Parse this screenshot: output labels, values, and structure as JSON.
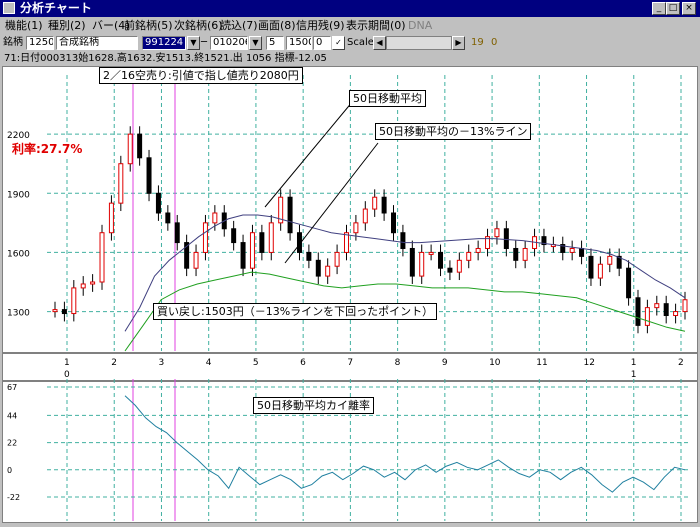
{
  "window": {
    "title": "分析チャート"
  },
  "menu": [
    "機能(1)",
    "種別(2)",
    "バー(4)",
    "前銘柄(5)",
    "次銘柄(6)",
    "読込(7)",
    "画面(8)",
    "信用残(9)",
    "表示期間(0)",
    "DNA"
  ],
  "toolbar": {
    "code_label": "銘柄",
    "code": "1250",
    "name": "合成銘柄",
    "field1": "991224",
    "field2": "010206",
    "field3": "5",
    "field4": "1500",
    "field5": "0",
    "scale_label": "Scale",
    "num1": "19",
    "num2": "0"
  },
  "info": "71:日付000313始1628.高1632.安1513.終1521.出 1056 指標-12.05",
  "annotations": {
    "sell": "2／16空売り:引値で指し値売り2080円",
    "ma50": "50日移動平均",
    "ma50_minus": "50日移動平均の－13%ライン",
    "buyback": "買い戻し:1503円（－13%ラインを下回ったポイント）",
    "profit": "利率:27.7%",
    "deviation": "50日移動平均カイ離率"
  },
  "chart_data": [
    {
      "type": "line",
      "title": "",
      "yticks": [
        2200,
        1900,
        1600,
        1300
      ],
      "ylim": [
        1100,
        2500
      ],
      "xticks": [
        "1",
        "2",
        "3",
        "4",
        "5",
        "6",
        "7",
        "8",
        "9",
        "10",
        "11",
        "12",
        "1",
        "2"
      ],
      "year_markers": [
        "0",
        "1"
      ],
      "series": [
        {
          "name": "",
          "values": [
            1310,
            1290,
            1420,
            1440,
            1450,
            1700,
            1850,
            2050,
            2200,
            2080,
            1900,
            1800,
            1750,
            1650,
            1520,
            1600,
            1750,
            1800,
            1720,
            1650,
            1520,
            1700,
            1600,
            1750,
            1880,
            1700,
            1600,
            1560,
            1480,
            1530,
            1600,
            1700,
            1750,
            1820,
            1880,
            1800,
            1700,
            1620,
            1480,
            1600,
            1600,
            1520,
            1500,
            1560,
            1600,
            1620,
            1680,
            1720,
            1620,
            1560,
            1620,
            1680,
            1640,
            1640,
            1600,
            1620,
            1580,
            1470,
            1540,
            1580,
            1520,
            1370,
            1230,
            1320,
            1340,
            1280,
            1300,
            1360
          ]
        },
        {
          "name": "",
          "values": [
            1200,
            1320,
            1480,
            1560,
            1620,
            1680,
            1730,
            1770,
            1790,
            1790,
            1780,
            1760,
            1740,
            1720,
            1700,
            1690,
            1680,
            1670,
            1660,
            1650,
            1650,
            1655,
            1660,
            1665,
            1670,
            1670,
            1665,
            1660,
            1650,
            1640,
            1630,
            1620,
            1610,
            1590,
            1560,
            1510,
            1460,
            1420,
            1370
          ]
        },
        {
          "name": "",
          "values": [
            1100,
            1230,
            1360,
            1410,
            1440,
            1460,
            1480,
            1500,
            1490,
            1470,
            1450,
            1430,
            1420,
            1430,
            1440,
            1440,
            1430,
            1420,
            1420,
            1420,
            1410,
            1400,
            1400,
            1390,
            1380,
            1370,
            1340,
            1310,
            1280,
            1250,
            1220,
            1200
          ]
        }
      ]
    },
    {
      "type": "line",
      "title": "",
      "yticks": [
        67,
        44,
        22,
        0,
        -22
      ],
      "ylim": [
        -22,
        67
      ],
      "series": [
        {
          "name": "",
          "values": [
            60,
            52,
            42,
            35,
            30,
            22,
            15,
            8,
            0,
            -5,
            -15,
            2,
            -5,
            -12,
            -8,
            -4,
            -8,
            -15,
            -12,
            -5,
            -2,
            -8,
            -3,
            3,
            0,
            -6,
            -2,
            -8,
            0,
            4,
            -2,
            3,
            6,
            2,
            0,
            4,
            8,
            2,
            -3,
            -6,
            0,
            -2,
            -8,
            -2,
            2,
            -4,
            -12,
            -18,
            -10,
            -6,
            -10,
            -16,
            -6,
            2,
            0
          ]
        }
      ]
    }
  ]
}
